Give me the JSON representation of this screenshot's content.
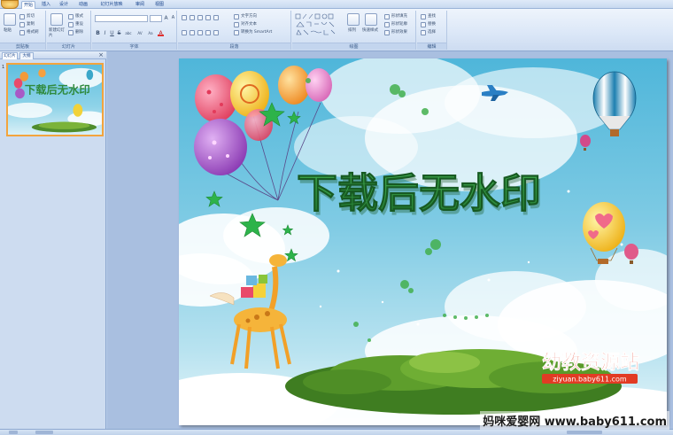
{
  "ribbon": {
    "tabs": [
      "开始",
      "插入",
      "设计",
      "动画",
      "幻灯片放映",
      "审阅",
      "视图"
    ],
    "active_tab": "开始",
    "groups": {
      "clipboard": {
        "label": "剪贴板",
        "paste": "粘贴",
        "cut": "剪切",
        "copy": "复制",
        "format_painter": "格式刷"
      },
      "slides": {
        "label": "幻灯片",
        "new_slide": "新建幻灯片",
        "layout": "版式",
        "reset": "重设",
        "delete": "删除"
      },
      "font": {
        "label": "字体",
        "bold": "B",
        "italic": "I",
        "underline": "U",
        "strike": "S",
        "shadow": "abc",
        "spacing": "AV",
        "case": "Aa",
        "font_color": "A",
        "grow": "A",
        "shrink": "A"
      },
      "paragraph": {
        "label": "段落",
        "text_direction": "文字方向",
        "align_text": "对齐文本",
        "smartart": "转换为 SmartArt"
      },
      "drawing": {
        "label": "绘图",
        "arrange": "排列",
        "quick_styles": "快速样式",
        "shape_fill": "形状填充",
        "shape_outline": "形状轮廓",
        "shape_effects": "形状效果"
      },
      "editing": {
        "label": "编辑",
        "find": "查找",
        "replace": "替换",
        "select": "选择"
      }
    }
  },
  "left_panel": {
    "tabs": [
      "幻灯片",
      "大纲"
    ],
    "close": "×",
    "slide_number": "1",
    "thumbnail_title": "下载后无水印"
  },
  "slide": {
    "title": "下载后无水印",
    "logo_text": "幼教资源站",
    "logo_url": "ziyuan.baby611.com"
  },
  "watermark": "妈咪爱婴网 www.baby611.com",
  "colors": {
    "title_green": "#2f8a3e",
    "sky": "#6fc8e2",
    "logo_red": "#e23b24"
  }
}
